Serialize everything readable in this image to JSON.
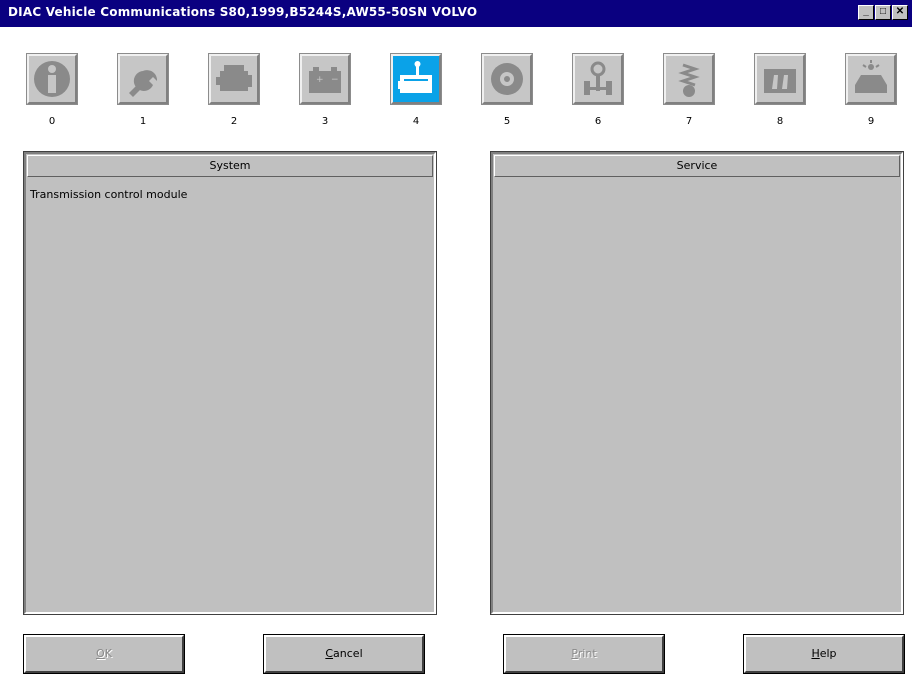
{
  "window": {
    "title": "DIAC  Vehicle Communications S80,1999,B5244S,AW55-50SN VOLVO",
    "minimize_icon": "minimize-icon",
    "maximize_icon": "maximize-icon",
    "close_icon": "close-icon"
  },
  "toolbar": {
    "selected_index": 4,
    "icons": [
      {
        "num": "0",
        "icon": "information-icon"
      },
      {
        "num": "1",
        "icon": "wrench-icon"
      },
      {
        "num": "2",
        "icon": "engine-icon"
      },
      {
        "num": "3",
        "icon": "battery-icon"
      },
      {
        "num": "4",
        "icon": "transmission-icon"
      },
      {
        "num": "5",
        "icon": "brake-icon"
      },
      {
        "num": "6",
        "icon": "steering-chassis-icon"
      },
      {
        "num": "7",
        "icon": "suspension-icon"
      },
      {
        "num": "8",
        "icon": "seat-interior-icon"
      },
      {
        "num": "9",
        "icon": "car-alarm-icon"
      }
    ]
  },
  "system_panel": {
    "header": "System",
    "items": [
      "Transmission control module"
    ]
  },
  "service_panel": {
    "header": "Service",
    "items": []
  },
  "buttons": {
    "ok": {
      "accel": "O",
      "rest": "K",
      "enabled": false
    },
    "cancel": {
      "accel": "C",
      "rest": "ancel",
      "enabled": true
    },
    "print": {
      "accel": "P",
      "rest": "rint",
      "enabled": false
    },
    "help": {
      "accel": "H",
      "rest": "elp",
      "enabled": true
    }
  },
  "colors": {
    "titlebar": "#0a0080",
    "face": "#c0c0c0",
    "active_tile": "#0aa2e8"
  }
}
